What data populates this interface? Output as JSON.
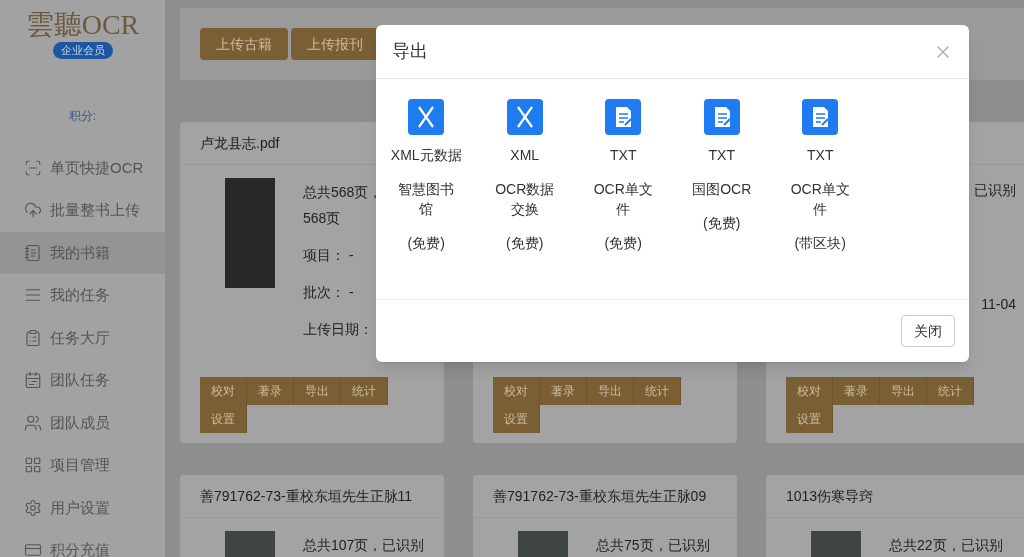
{
  "sidebar": {
    "logo": "雲聽OCR",
    "badge": "企业会员",
    "points_label": "积分:",
    "items": [
      {
        "label": "单页快捷OCR",
        "selected": false
      },
      {
        "label": "批量整书上传",
        "selected": false
      },
      {
        "label": "我的书籍",
        "selected": true
      },
      {
        "label": "我的任务",
        "selected": false
      },
      {
        "label": "任务大厅",
        "selected": false
      },
      {
        "label": "团队任务",
        "selected": false
      },
      {
        "label": "团队成员",
        "selected": false
      },
      {
        "label": "项目管理",
        "selected": false
      },
      {
        "label": "用户设置",
        "selected": false
      },
      {
        "label": "积分充值",
        "selected": false
      }
    ]
  },
  "toolbar": {
    "buttons": [
      "上传古籍",
      "上传报刊"
    ]
  },
  "cards": [
    {
      "kind": "full",
      "title": "卢龙县志.pdf",
      "lines": [
        "总共568页，",
        "568页",
        "项目： -",
        "批次： -",
        "上传日期："
      ],
      "buttons": [
        "校对",
        "著录",
        "导出",
        "统计",
        "设置"
      ]
    },
    {
      "kind": "covered",
      "buttons": [
        "校对",
        "著录",
        "导出",
        "统计",
        "设置"
      ]
    },
    {
      "kind": "tail",
      "lines": [
        "已识别",
        "11-04"
      ],
      "buttons": [
        "校对",
        "著录",
        "导出",
        "统计",
        "设置"
      ]
    },
    {
      "kind": "full",
      "title": "善791762-73-重校东垣先生正脉11",
      "lines": [
        "总共107页，已识别"
      ]
    },
    {
      "kind": "full",
      "title": "善791762-73-重校东垣先生正脉09",
      "lines": [
        "总共75页，已识别"
      ]
    },
    {
      "kind": "full",
      "title": "1013伤寒导窍",
      "lines": [
        "总共22页，已识别"
      ]
    }
  ],
  "dialog": {
    "title": "导出",
    "close_button": "关闭",
    "options": [
      {
        "kind": "xml",
        "format": "XML元数据",
        "description": "智慧图书馆",
        "note": "(免费)"
      },
      {
        "kind": "xml",
        "format": "XML",
        "description": "OCR数据交换",
        "note": "(免费)"
      },
      {
        "kind": "txt",
        "format": "TXT",
        "description": "OCR单文件",
        "note": "(免费)"
      },
      {
        "kind": "txt",
        "format": "TXT",
        "description": "国图OCR",
        "note": "(免费)"
      },
      {
        "kind": "txt",
        "format": "TXT",
        "description": "OCR单文件",
        "note": "(带区块)"
      }
    ]
  }
}
